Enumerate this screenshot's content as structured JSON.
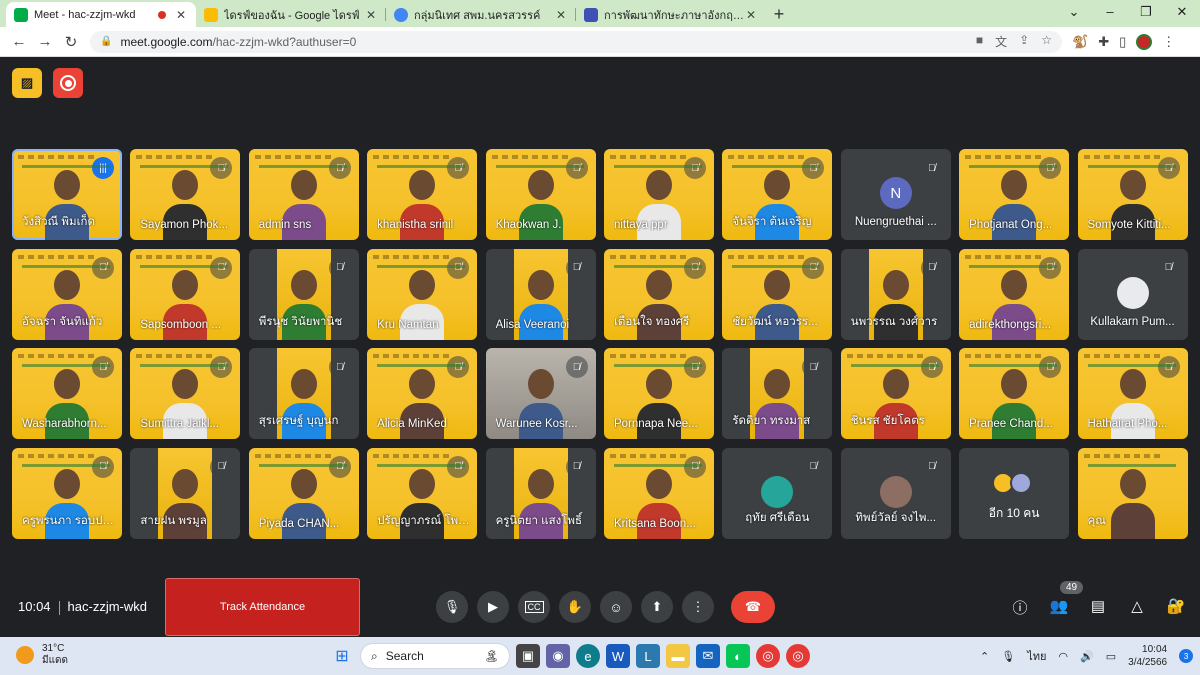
{
  "browser": {
    "tabs": [
      {
        "title": "Meet - hac-zzjm-wkd",
        "favicon_color": "#00ac47",
        "recording": true,
        "active": true
      },
      {
        "title": "ไดรฟ์ของฉัน - Google ไดรฟ์",
        "favicon_color": "#fbbc04",
        "recording": false,
        "active": false
      },
      {
        "title": "กลุ่มนิเทศ สพม.นครสวรรค์",
        "favicon_color": "#4285f4",
        "recording": false,
        "active": false
      },
      {
        "title": "การพัฒนาทักษะภาษาอังกฤษ English",
        "favicon_color": "#3f51b5",
        "recording": false,
        "active": false
      }
    ],
    "new_tab": "+",
    "window_controls": {
      "collapse": "⌄",
      "minimize": "–",
      "restore": "❐",
      "close": "✕"
    },
    "url_host": "meet.google.com",
    "url_path": "/hac-zzjm-wkd?authuser=0",
    "nav": {
      "back": "←",
      "forward": "→",
      "reload": "↻"
    }
  },
  "meet": {
    "participants": [
      {
        "name": "วังสิวณี พิมเก็ด",
        "video": "yellow",
        "speaking": true,
        "selfview": true
      },
      {
        "name": "Sayamon Phok...",
        "video": "yellow"
      },
      {
        "name": "admin sns",
        "video": "yellow"
      },
      {
        "name": "khanistha srinil",
        "video": "yellow"
      },
      {
        "name": "Khaokwan J.",
        "video": "yellow"
      },
      {
        "name": "nittaya ppr",
        "video": "yellow"
      },
      {
        "name": "จันจิรา ต้นเจริญ",
        "video": "yellow"
      },
      {
        "name": "Nuengruethai ...",
        "video": "none",
        "avatar_letter": "N",
        "avatar_color": "#5c6bc0"
      },
      {
        "name": "Photjanat Ong...",
        "video": "yellow"
      },
      {
        "name": "Somyote Kittiti...",
        "video": "yellow"
      },
      {
        "name": "อัจฉรา จันทิแก้ว",
        "video": "yellow"
      },
      {
        "name": "Sapsomboon ...",
        "video": "yellow"
      },
      {
        "name": "พีรนุช วินัยพานิช",
        "video": "narrow"
      },
      {
        "name": "Kru Namtan",
        "video": "yellow"
      },
      {
        "name": "Alisa Veeranoi",
        "video": "narrow"
      },
      {
        "name": "เตือนใจ ทองศรี",
        "video": "yellow"
      },
      {
        "name": "ชัยวัฒน์ หอวรร...",
        "video": "yellow"
      },
      {
        "name": "นพวรรณ วงศ์วาร",
        "video": "narrow"
      },
      {
        "name": "adirekthongsri...",
        "video": "yellow"
      },
      {
        "name": "Kullakarn Pum...",
        "video": "none",
        "avatar_letter": "",
        "avatar_color": "#e8eaed"
      },
      {
        "name": "Washarabhorn...",
        "video": "yellow"
      },
      {
        "name": "Sumittra Jaikl...",
        "video": "yellow"
      },
      {
        "name": "สุรเศรษฐ์ บุญนก",
        "video": "narrow"
      },
      {
        "name": "Alicia MinKed",
        "video": "yellow"
      },
      {
        "name": "Warunee Kosr...",
        "video": "grey"
      },
      {
        "name": "Pornnapa Nee...",
        "video": "yellow"
      },
      {
        "name": "รัดดิยา ทรงมาส",
        "video": "narrow"
      },
      {
        "name": "ชินรส ชัยโคตร",
        "video": "yellow"
      },
      {
        "name": "Pranee Chand...",
        "video": "yellow"
      },
      {
        "name": "Hathairat Pho...",
        "video": "yellow"
      },
      {
        "name": "ครูพรนภา รอบประ...",
        "video": "yellow"
      },
      {
        "name": "สายฝน พรมูล",
        "video": "narrow"
      },
      {
        "name": "Piyada CHAN...",
        "video": "yellow"
      },
      {
        "name": "ปรัญญาภรณ์ โพธิ์ไพ...",
        "video": "yellow"
      },
      {
        "name": "ครูนิตยา แสงโพธิ์",
        "video": "narrow"
      },
      {
        "name": "Kritsana Boon...",
        "video": "yellow"
      },
      {
        "name": "ฤทัย ศรีเดือน",
        "video": "none",
        "avatar_letter": "",
        "avatar_color": "#26a69a"
      },
      {
        "name": "ทิพย์วัลย์ จงไพ...",
        "video": "none",
        "avatar_letter": "",
        "avatar_color": "#8d6e63"
      },
      {
        "name": "อีก 10 คน",
        "video": "more"
      },
      {
        "name": "คุณ",
        "video": "yellow",
        "no_mic": true
      }
    ],
    "bottom": {
      "time": "10:04",
      "meeting_code": "hac-zzjm-wkd",
      "track_attendance": "Track Attendance",
      "participant_count": "49"
    }
  },
  "taskbar": {
    "temperature": "31°C",
    "weather_desc": "มีแดด",
    "search_label": "Search",
    "lang": "ไทย",
    "clock_time": "10:04",
    "clock_date": "3/4/2566",
    "notification_count": "3"
  }
}
